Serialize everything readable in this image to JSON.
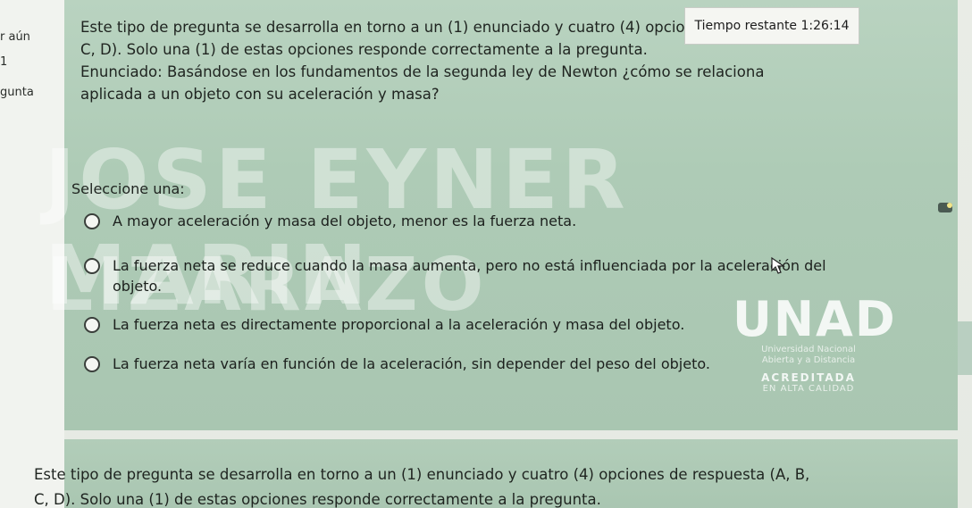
{
  "timer": {
    "label": "Tiempo restante",
    "value": "1:26:14"
  },
  "sidebar_fragments": [
    "r aún",
    "1",
    "gunta"
  ],
  "question": {
    "intro_line1": "Este tipo de pregunta se desarrolla en torno a un (1) enunciado y cuatro (4) opciones de respuesta (A, B,",
    "intro_line2": "C, D). Solo una (1) de estas opciones responde correctamente a la pregunta.",
    "statement_line1": "Enunciado: Basándose en los fundamentos de la segunda ley de Newton ¿cómo se relaciona",
    "statement_line2": "aplicada a un objeto con su aceleración y masa?",
    "select_label": "Seleccione una:",
    "options": [
      "A mayor aceleración y masa del objeto, menor es la fuerza neta.",
      "La fuerza neta se reduce cuando la masa aumenta, pero no está influenciada por la aceleración del objeto.",
      "La fuerza neta es directamente proporcional a la aceleración y masa del objeto.",
      "La fuerza neta varía en función de la aceleración, sin depender del peso del objeto."
    ]
  },
  "watermark": {
    "line1": "JOSE EYNER MARIN",
    "line2": "LIZARAZO"
  },
  "logo": {
    "brand": "UNAD",
    "university": "Universidad Nacional",
    "subtitle": "Abierta y a Distancia",
    "accredited": "ACREDITADA",
    "quality": "EN ALTA CALIDAD"
  },
  "next_question": {
    "line1": "Este tipo de pregunta se desarrolla en torno a un (1) enunciado y cuatro (4) opciones de respuesta (A, B,",
    "line2": "C, D). Solo una (1) de estas opciones responde correctamente a la pregunta."
  }
}
